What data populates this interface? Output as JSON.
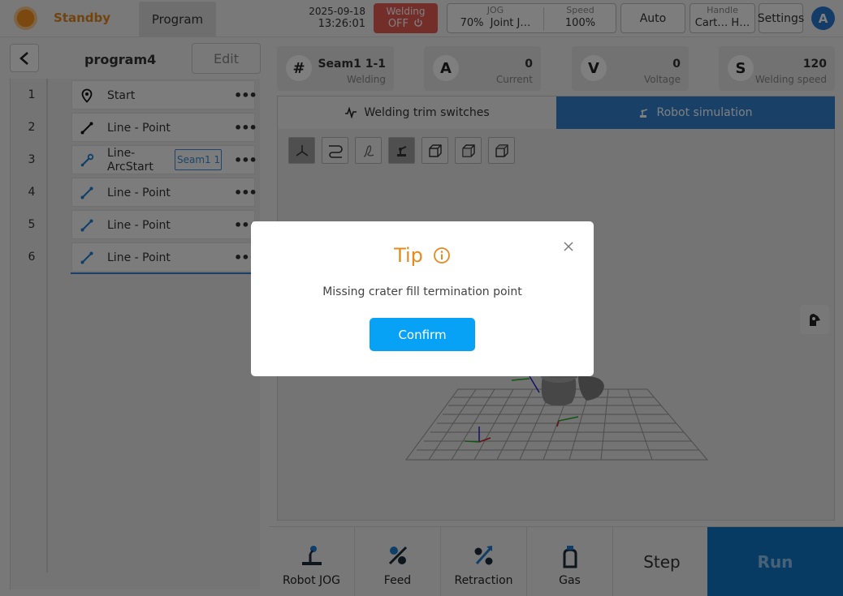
{
  "header": {
    "status_label": "Standby",
    "program_tab": "Program",
    "date": "2025-09-18",
    "time": "13:26:01",
    "welding_label": "Welding",
    "welding_state": "OFF",
    "jog_label": "JOG",
    "jog_percent": "70%",
    "jog_mode": "Joint J…",
    "speed_label": "Speed",
    "speed_value": "100%",
    "mode": "Auto",
    "handle_label": "Handle",
    "handle_value": "Cart…  H…",
    "settings": "Settings",
    "user_initial": "A",
    "colors": {
      "status": "#f7931e",
      "welding_off": "#e85c55",
      "accent": "#3283d1"
    }
  },
  "program": {
    "name": "program4",
    "edit_label": "Edit",
    "rows": [
      {
        "num": "1",
        "label": "Start",
        "icon": "location-pin-icon"
      },
      {
        "num": "2",
        "label": "Line - Point",
        "icon": "line-tool-icon"
      },
      {
        "num": "3",
        "label": "Line-ArcStart",
        "icon": "weld-torch-icon",
        "tag": "Seam1 1"
      },
      {
        "num": "4",
        "label": "Line - Point",
        "icon": "line-tool-icon"
      },
      {
        "num": "5",
        "label": "Line - Point",
        "icon": "line-tool-icon"
      },
      {
        "num": "6",
        "label": "Line - Point",
        "icon": "line-tool-icon"
      }
    ],
    "more_glyph": "•••"
  },
  "info": {
    "seam": {
      "symbol": "#",
      "value": "Seam1 1-1",
      "label": "Welding"
    },
    "current": {
      "symbol": "A",
      "value": "0",
      "label": "Current"
    },
    "voltage": {
      "symbol": "V",
      "value": "0",
      "label": "Voltage"
    },
    "speed": {
      "symbol": "S",
      "value": "120",
      "label": "Welding speed"
    }
  },
  "sim": {
    "tab_trim": "Welding trim switches",
    "tab_sim": "Robot simulation"
  },
  "bottom": {
    "robot_jog": "Robot JOG",
    "feed": "Feed",
    "retraction": "Retraction",
    "gas": "Gas",
    "step": "Step",
    "run": "Run"
  },
  "modal": {
    "title": "Tip",
    "message": "Missing crater fill termination point",
    "confirm": "Confirm"
  }
}
